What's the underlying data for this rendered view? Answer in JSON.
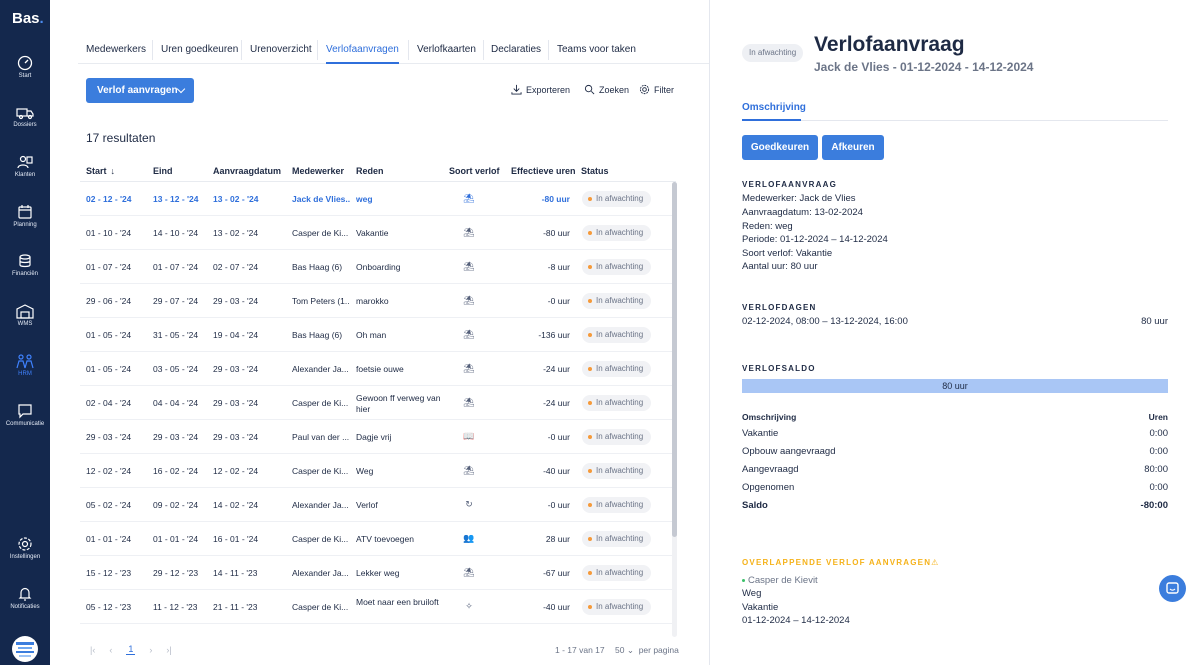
{
  "app": {
    "logo": "Bas",
    "logo_dot": "."
  },
  "sidebar": {
    "items": [
      {
        "label": "Start",
        "icon": "dashboard-icon"
      },
      {
        "label": "Dossiers",
        "icon": "truck-icon"
      },
      {
        "label": "Klanten",
        "icon": "customers-icon"
      },
      {
        "label": "Planning",
        "icon": "calendar-icon"
      },
      {
        "label": "Financiën",
        "icon": "coins-icon"
      },
      {
        "label": "WMS",
        "icon": "warehouse-icon"
      },
      {
        "label": "HRM",
        "icon": "people-icon"
      },
      {
        "label": "Communicatie",
        "icon": "chat-icon"
      },
      {
        "label": "Instellingen",
        "icon": "gear-icon"
      },
      {
        "label": "Notificaties",
        "icon": "bell-icon"
      }
    ],
    "active": "HRM"
  },
  "tabs": [
    "Medewerkers",
    "Uren goedkeuren",
    "Urenoverzicht",
    "Verlofaanvragen",
    "Verlofkaarten",
    "Declaraties",
    "Teams voor taken"
  ],
  "active_tab": "Verlofaanvragen",
  "toolbar": {
    "primary": "Verlof aanvragen",
    "export": "Exporteren",
    "search": "Zoeken",
    "filter": "Filter"
  },
  "results_label": "17 resultaten",
  "table": {
    "headers": {
      "start": "Start",
      "eind": "Eind",
      "aanvraagdatum": "Aanvraagdatum",
      "medewerker": "Medewerker",
      "reden": "Reden",
      "soort": "Soort verlof",
      "uren": "Effectieve uren",
      "status": "Status"
    },
    "rows": [
      {
        "start": "02 - 12 - '24",
        "eind": "13 - 12 - '24",
        "aanvraag": "13 - 02 - '24",
        "medewerker": "Jack de Vlies...",
        "reden": "weg",
        "soort": "beach-icon",
        "glyph": "⛱",
        "uren": "-80 uur",
        "status": "In afwachting"
      },
      {
        "start": "01 - 10 - '24",
        "eind": "14 - 10 - '24",
        "aanvraag": "13 - 02 - '24",
        "medewerker": "Casper de Ki...",
        "reden": "Vakantie",
        "soort": "beach-icon",
        "glyph": "⛱",
        "uren": "-80 uur",
        "status": "In afwachting"
      },
      {
        "start": "01 - 07 - '24",
        "eind": "01 - 07 - '24",
        "aanvraag": "02 - 07 - '24",
        "medewerker": "Bas Haag (6)",
        "reden": "Onboarding",
        "soort": "beach-icon",
        "glyph": "⛱",
        "uren": "-8 uur",
        "status": "In afwachting"
      },
      {
        "start": "29 - 06 - '24",
        "eind": "29 - 07 - '24",
        "aanvraag": "29 - 03 - '24",
        "medewerker": "Tom Peters (1...",
        "reden": "marokko",
        "soort": "beach-icon",
        "glyph": "⛱",
        "uren": "-0 uur",
        "status": "In afwachting"
      },
      {
        "start": "01 - 05 - '24",
        "eind": "31 - 05 - '24",
        "aanvraag": "19 - 04 - '24",
        "medewerker": "Bas Haag (6)",
        "reden": "Oh man",
        "soort": "beach-icon",
        "glyph": "⛱",
        "uren": "-136 uur",
        "status": "In afwachting"
      },
      {
        "start": "01 - 05 - '24",
        "eind": "03 - 05 - '24",
        "aanvraag": "29 - 03 - '24",
        "medewerker": "Alexander Ja...",
        "reden": "foetsie ouwe",
        "soort": "beach-icon",
        "glyph": "⛱",
        "uren": "-24 uur",
        "status": "In afwachting"
      },
      {
        "start": "02 - 04 - '24",
        "eind": "04 - 04 - '24",
        "aanvraag": "29 - 03 - '24",
        "medewerker": "Casper de Ki...",
        "reden": "Gewoon ff verweg van hier",
        "soort": "beach-icon",
        "glyph": "⛱",
        "uren": "-24 uur",
        "status": "In afwachting"
      },
      {
        "start": "29 - 03 - '24",
        "eind": "29 - 03 - '24",
        "aanvraag": "29 - 03 - '24",
        "medewerker": "Paul van der ...",
        "reden": "Dagje vrij",
        "soort": "book-icon",
        "glyph": "📖",
        "uren": "-0 uur",
        "status": "In afwachting"
      },
      {
        "start": "12 - 02 - '24",
        "eind": "16 - 02 - '24",
        "aanvraag": "12 - 02 - '24",
        "medewerker": "Casper de Ki...",
        "reden": "Weg",
        "soort": "beach-icon",
        "glyph": "⛱",
        "uren": "-40 uur",
        "status": "In afwachting"
      },
      {
        "start": "05 - 02 - '24",
        "eind": "09 - 02 - '24",
        "aanvraag": "14 - 02 - '24",
        "medewerker": "Alexander Ja...",
        "reden": "Verlof",
        "soort": "reload-icon",
        "glyph": "↻",
        "uren": "-0 uur",
        "status": "In afwachting"
      },
      {
        "start": "01 - 01 - '24",
        "eind": "01 - 01 - '24",
        "aanvraag": "16 - 01 - '24",
        "medewerker": "Casper de Ki...",
        "reden": "ATV toevoegen",
        "soort": "people-icon",
        "glyph": "👥",
        "uren": "28 uur",
        "status": "In afwachting"
      },
      {
        "start": "15 - 12 - '23",
        "eind": "29 - 12 - '23",
        "aanvraag": "14 - 11 - '23",
        "medewerker": "Alexander Ja...",
        "reden": "Lekker weg",
        "soort": "beach-icon",
        "glyph": "⛱",
        "uren": "-67 uur",
        "status": "In afwachting"
      },
      {
        "start": "05 - 12 - '23",
        "eind": "11 - 12 - '23",
        "aanvraag": "21 - 11 - '23",
        "medewerker": "Casper de Ki...",
        "reden": "Moet naar een bruiloft",
        "soort": "sparkle-icon",
        "glyph": "✧",
        "uren": "-40 uur",
        "status": "In afwachting"
      }
    ]
  },
  "pager": {
    "first": "|‹",
    "prev": "‹",
    "current": "1",
    "next": "›",
    "last": "›|",
    "info": "1 - 17 van 17",
    "size": "50",
    "size_suffix": "per pagina"
  },
  "detail": {
    "status": "In afwachting",
    "title": "Verlofaanvraag",
    "subtitle": "Jack de Vlies - 01-12-2024 - 14-12-2024",
    "tab": "Omschrijving",
    "approve": "Goedkeuren",
    "reject": "Afkeuren",
    "request_head": "VERLOFAANVRAAG",
    "request_lines": [
      "Medewerker: Jack de Vlies",
      "Aanvraagdatum: 13-02-2024",
      "Reden: weg",
      "Periode: 01-12-2024 – 14-12-2024",
      "Soort verlof: Vakantie",
      "Aantal uur: 80 uur"
    ],
    "days_head": "VERLOFDAGEN",
    "days_range": "02-12-2024, 08:00 – 13-12-2024, 16:00",
    "days_hours": "80 uur",
    "saldo_head": "VERLOFSALDO",
    "saldo_bar": "80 uur",
    "balance_headers": {
      "desc": "Omschrijving",
      "hours": "Uren"
    },
    "balance": [
      {
        "label": "Vakantie",
        "value": "0:00"
      },
      {
        "label": "Opbouw aangevraagd",
        "value": "0:00"
      },
      {
        "label": "Aangevraagd",
        "value": "80:00"
      },
      {
        "label": "Opgenomen",
        "value": "0:00"
      }
    ],
    "balance_total": {
      "label": "Saldo",
      "value": "-80:00"
    },
    "overlap_head": "OVERLAPPENDE VERLOF AANVRAGEN⚠",
    "overlap": {
      "name": "Casper de Kievit",
      "reason": "Weg",
      "type": "Vakantie",
      "period": "01-12-2024 – 14-12-2024"
    }
  },
  "colors": {
    "sidebar": "#14284d",
    "accent": "#3b7ddd",
    "warning": "#f5b21a",
    "status_dot": "#f59a3a"
  }
}
